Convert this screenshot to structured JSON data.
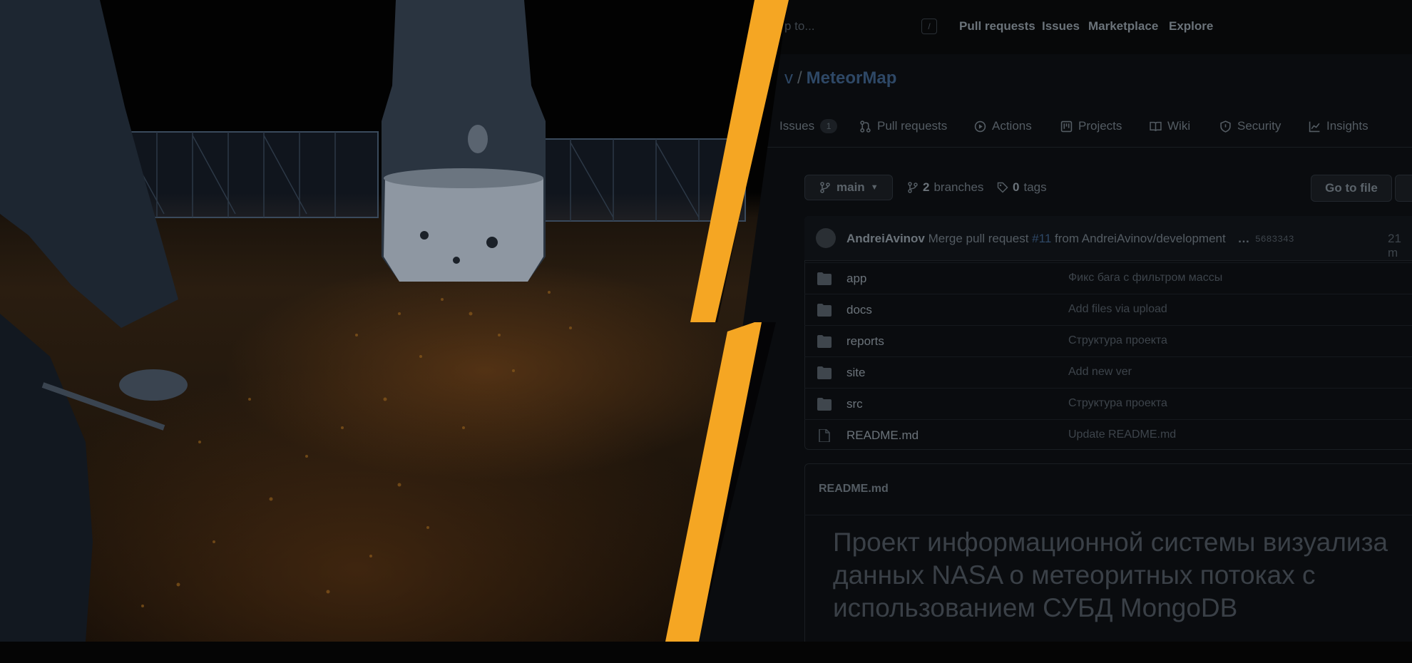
{
  "header": {
    "search_placeholder": "p to...",
    "slash_key": "/",
    "nav": [
      "Pull requests",
      "Issues",
      "Marketplace",
      "Explore"
    ]
  },
  "repo": {
    "owner_fragment": "v",
    "separator": "/",
    "name": "MeteorMap"
  },
  "tabs": [
    {
      "label": "Issues",
      "count": "1",
      "icon": "issue-icon"
    },
    {
      "label": "Pull requests",
      "icon": "pull-request-icon"
    },
    {
      "label": "Actions",
      "icon": "play-icon"
    },
    {
      "label": "Projects",
      "icon": "project-icon"
    },
    {
      "label": "Wiki",
      "icon": "book-icon"
    },
    {
      "label": "Security",
      "icon": "shield-icon"
    },
    {
      "label": "Insights",
      "icon": "graph-icon"
    }
  ],
  "branch_bar": {
    "branch": "main",
    "branches_count": "2",
    "branches_label": "branches",
    "tags_count": "0",
    "tags_label": "tags",
    "goto_label": "Go to file"
  },
  "commit": {
    "author": "AndreiAvinov",
    "message_prefix": "Merge pull request",
    "pr": "#11",
    "message_suffix": "from AndreiAvinov/development",
    "dots": "…",
    "hash": "5683343",
    "time": "21 m"
  },
  "files": [
    {
      "name": "app",
      "type": "folder",
      "message": "Фикс бага с фильтром массы"
    },
    {
      "name": "docs",
      "type": "folder",
      "message": "Add files via upload"
    },
    {
      "name": "reports",
      "type": "folder",
      "message": "Структура проекта"
    },
    {
      "name": "site",
      "type": "folder",
      "message": "Add new ver"
    },
    {
      "name": "src",
      "type": "folder",
      "message": "Структура проекта"
    },
    {
      "name": "README.md",
      "type": "file",
      "message": "Update README.md"
    }
  ],
  "readme": {
    "label": "README.md",
    "title_lines": [
      "Проект информационной системы визуализа",
      "данных NASA о метеоритных потоках с",
      "использованием СУБД MongoDB"
    ]
  },
  "colors": {
    "bolt": "#f5a623",
    "background": "#0a0c0f",
    "link": "#2e4866"
  }
}
